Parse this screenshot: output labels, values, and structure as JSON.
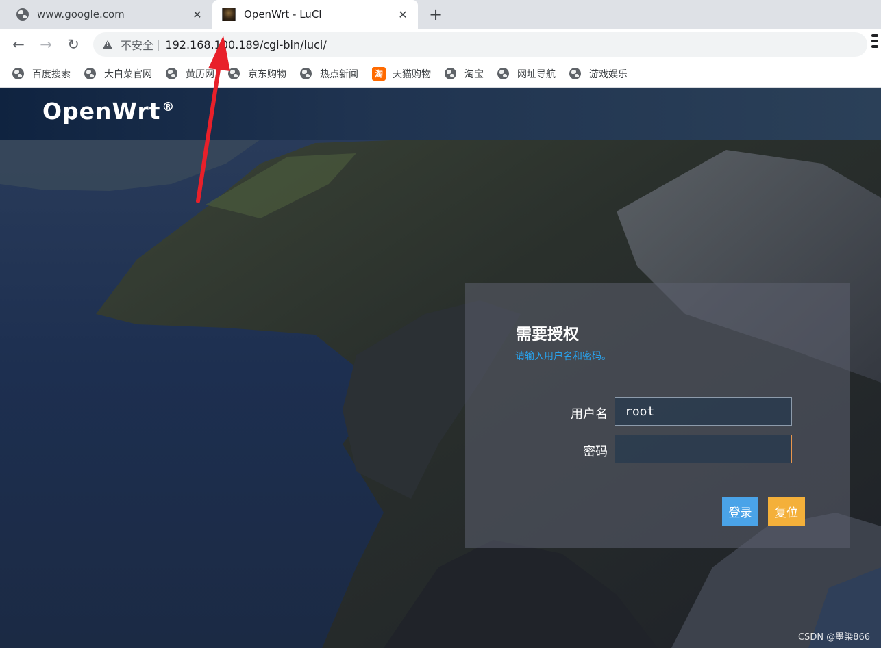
{
  "browser": {
    "tabs": [
      {
        "title": "www.google.com",
        "active": false
      },
      {
        "title": "OpenWrt - LuCI",
        "active": true
      }
    ],
    "tab_close_glyph": "✕",
    "new_tab_glyph": "+",
    "nav": {
      "back": "←",
      "forward": "→",
      "reload": "↻"
    },
    "address_bar": {
      "security_text": "不安全",
      "separator": "|",
      "url": "192.168.100.189/cgi-bin/luci/"
    },
    "bookmarks": [
      {
        "label": "百度搜索",
        "icon": "globe-icon"
      },
      {
        "label": "大白菜官网",
        "icon": "globe-icon"
      },
      {
        "label": "黄历网",
        "icon": "globe-icon"
      },
      {
        "label": "京东购物",
        "icon": "globe-icon"
      },
      {
        "label": "热点新闻",
        "icon": "globe-icon"
      },
      {
        "label": "天猫购物",
        "icon": "tmall-icon"
      },
      {
        "label": "淘宝",
        "icon": "globe-icon"
      },
      {
        "label": "网址导航",
        "icon": "globe-icon"
      },
      {
        "label": "游戏娱乐",
        "icon": "globe-icon"
      }
    ],
    "tmall_glyph": "淘"
  },
  "page": {
    "brand": "OpenWrt",
    "brand_mark": "®",
    "login": {
      "title": "需要授权",
      "subtitle": "请输入用户名和密码。",
      "username_label": "用户名",
      "username_value": "root",
      "password_label": "密码",
      "password_value": "",
      "login_button": "登录",
      "reset_button": "复位"
    },
    "watermark": "CSDN @墨染866"
  },
  "colors": {
    "accent_blue": "#29a3ee",
    "login_button": "#4aa3e8",
    "reset_button": "#f4b03a",
    "focus_border": "#e9964c",
    "annotation_arrow": "#e8202a"
  }
}
